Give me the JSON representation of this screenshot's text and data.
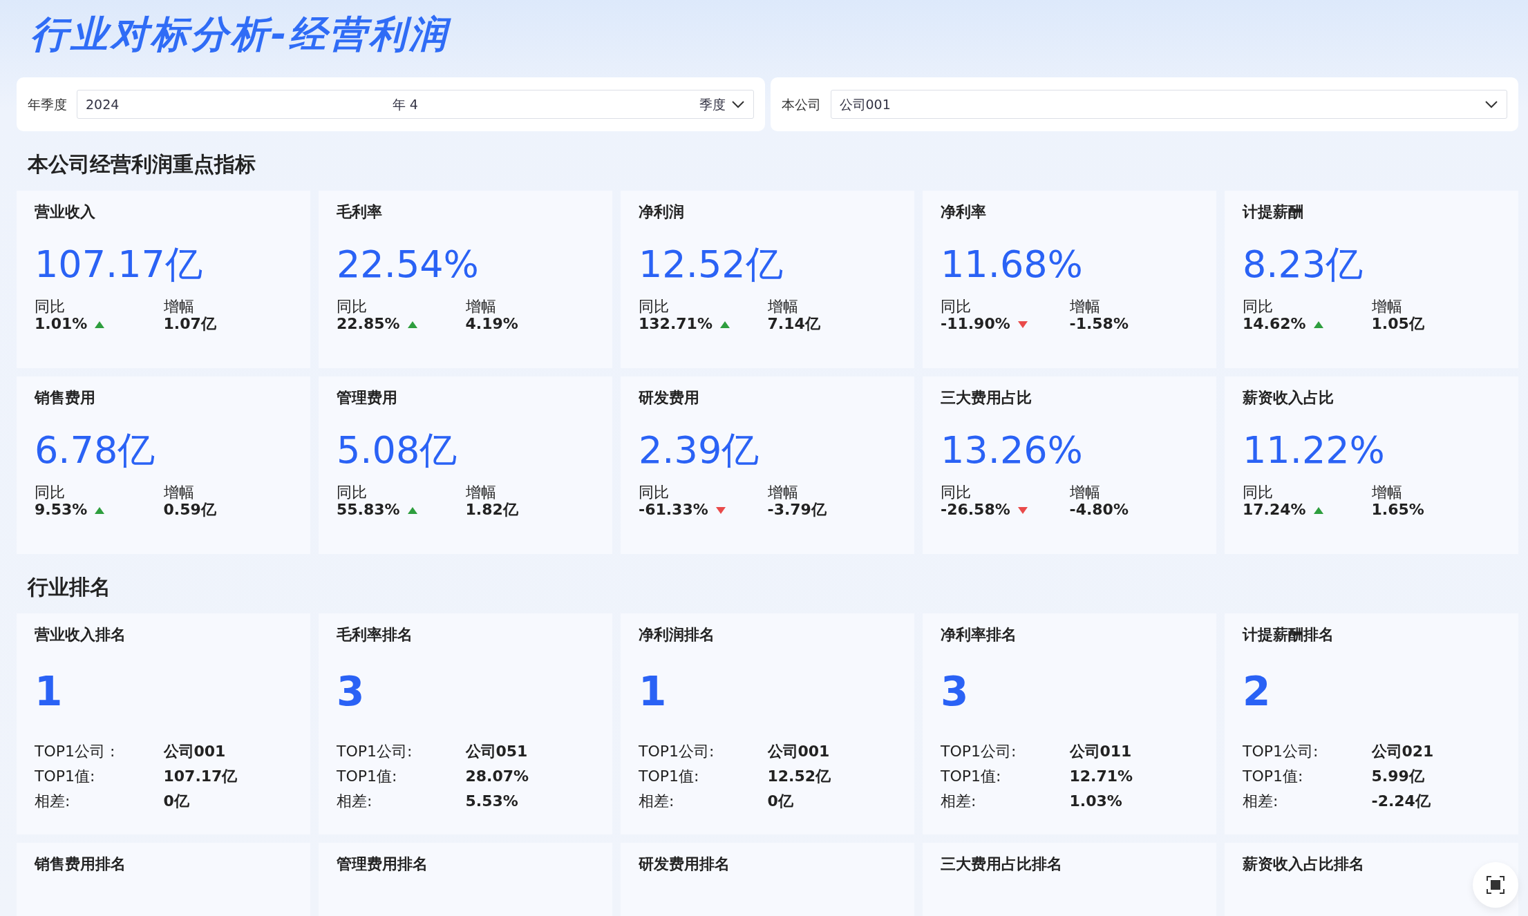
{
  "title": "行业对标分析-经营利润",
  "filters": [
    {
      "label": "年季度",
      "kind": "period",
      "year": "2024",
      "year_unit": "年",
      "quarter": "4",
      "quarter_unit": "季度"
    },
    {
      "label": "本公司",
      "kind": "select",
      "value": "公司001"
    }
  ],
  "indicators": {
    "title": "本公司经营利润重点指标",
    "cards": [
      {
        "name": "营业收入",
        "value": "107.17亿",
        "yoy_label": "同比",
        "yoy": "1.01%",
        "kind": "up",
        "inc_label": "增幅",
        "inc": "1.07亿"
      },
      {
        "name": "毛利率",
        "value": "22.54%",
        "yoy_label": "同比",
        "yoy": "22.85%",
        "kind": "up",
        "inc_label": "增幅",
        "inc": "4.19%"
      },
      {
        "name": "净利润",
        "value": "12.52亿",
        "yoy_label": "同比",
        "yoy": "132.71%",
        "kind": "up",
        "inc_label": "增幅",
        "inc": "7.14亿"
      },
      {
        "name": "净利率",
        "value": "11.68%",
        "yoy_label": "同比",
        "yoy": "-11.90%",
        "kind": "down",
        "inc_label": "增幅",
        "inc": "-1.58%"
      },
      {
        "name": "计提薪酬",
        "value": "8.23亿",
        "yoy_label": "同比",
        "yoy": "14.62%",
        "kind": "up",
        "inc_label": "增幅",
        "inc": "1.05亿"
      },
      {
        "name": "销售费用",
        "value": "6.78亿",
        "yoy_label": "同比",
        "yoy": "9.53%",
        "kind": "up",
        "inc_label": "增幅",
        "inc": "0.59亿"
      },
      {
        "name": "管理费用",
        "value": "5.08亿",
        "yoy_label": "同比",
        "yoy": "55.83%",
        "kind": "up",
        "inc_label": "增幅",
        "inc": "1.82亿"
      },
      {
        "name": "研发费用",
        "value": "2.39亿",
        "yoy_label": "同比",
        "yoy": "-61.33%",
        "kind": "down",
        "inc_label": "增幅",
        "inc": "-3.79亿"
      },
      {
        "name": "三大费用占比",
        "value": "13.26%",
        "yoy_label": "同比",
        "yoy": "-26.58%",
        "kind": "down",
        "inc_label": "增幅",
        "inc": "-4.80%"
      },
      {
        "name": "薪资收入占比",
        "value": "11.22%",
        "yoy_label": "同比",
        "yoy": "17.24%",
        "kind": "up",
        "inc_label": "增幅",
        "inc": "1.65%"
      }
    ]
  },
  "ranking": {
    "title": "行业排名",
    "cards": [
      {
        "name": "营业收入排名",
        "rank": "1",
        "rows": [
          {
            "label": "TOP1公司 :",
            "value": "公司001"
          },
          {
            "label": "TOP1值:",
            "value": "107.17亿"
          },
          {
            "label": "相差:",
            "value": "0亿"
          }
        ]
      },
      {
        "name": "毛利率排名",
        "rank": "3",
        "rows": [
          {
            "label": "TOP1公司:",
            "value": "公司051"
          },
          {
            "label": "TOP1值:",
            "value": "28.07%"
          },
          {
            "label": "相差:",
            "value": "5.53%"
          }
        ]
      },
      {
        "name": "净利润排名",
        "rank": "1",
        "rows": [
          {
            "label": "TOP1公司:",
            "value": "公司001"
          },
          {
            "label": "TOP1值:",
            "value": "12.52亿"
          },
          {
            "label": "相差:",
            "value": "0亿"
          }
        ]
      },
      {
        "name": "净利率排名",
        "rank": "3",
        "rows": [
          {
            "label": "TOP1公司:",
            "value": "公司011"
          },
          {
            "label": "TOP1值:",
            "value": "12.71%"
          },
          {
            "label": "相差:",
            "value": "1.03%"
          }
        ]
      },
      {
        "name": "计提薪酬排名",
        "rank": "2",
        "rows": [
          {
            "label": "TOP1公司:",
            "value": "公司021"
          },
          {
            "label": "TOP1值:",
            "value": "5.99亿"
          },
          {
            "label": "相差:",
            "value": "-2.24亿"
          }
        ]
      },
      {
        "name": "销售费用排名"
      },
      {
        "name": "管理费用排名"
      },
      {
        "name": "研发费用排名"
      },
      {
        "name": "三大费用占比排名"
      },
      {
        "name": "薪资收入占比排名"
      }
    ]
  }
}
